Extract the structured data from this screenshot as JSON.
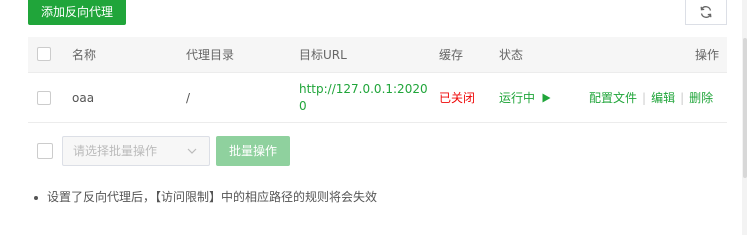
{
  "toolbar": {
    "add_label": "添加反向代理",
    "refresh_icon": "refresh-icon"
  },
  "table": {
    "headers": {
      "name": "名称",
      "dir": "代理目录",
      "url": "目标URL",
      "cache": "缓存",
      "status": "状态",
      "ops": "操作"
    },
    "rows": [
      {
        "name": "oaa",
        "dir": "/",
        "url": "http://127.0.0.1:20200",
        "cache": "已关闭",
        "status": "运行中",
        "status_icon": "play-icon",
        "op_config": "配置文件",
        "op_edit": "编辑",
        "op_delete": "删除"
      }
    ]
  },
  "batch": {
    "placeholder": "请选择批量操作",
    "button": "批量操作"
  },
  "note": "设置了反向代理后，【访问限制】中的相应路径的规则将会失效",
  "colors": {
    "primary": "#20a53a",
    "danger": "#ef0808",
    "disabled_primary": "#8fd19e"
  }
}
